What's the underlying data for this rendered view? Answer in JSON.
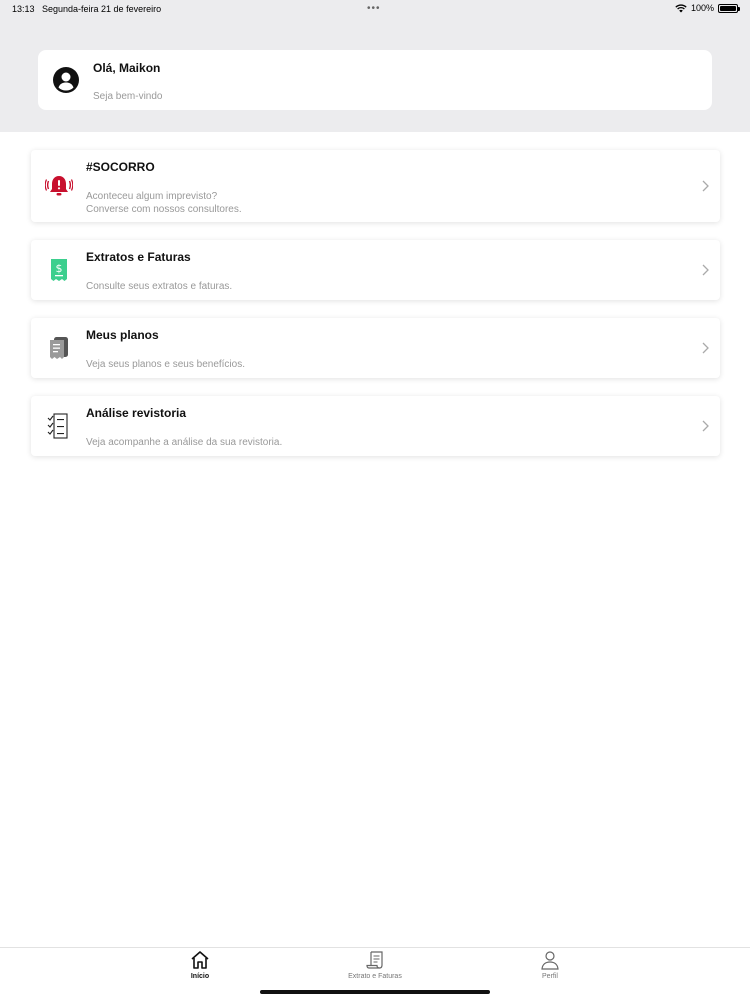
{
  "status_bar": {
    "time": "13:13",
    "date": "Segunda-feira 21 de fevereiro",
    "dots": "•••",
    "battery": "100%",
    "battery_level": 1.0
  },
  "greeting": {
    "title": "Olá, Maikon",
    "subtitle": "Seja bem-vindo",
    "icon": "user-circle-icon"
  },
  "menu": {
    "items": [
      {
        "title": "#SOCORRO",
        "desc_line1": "Aconteceu algum imprevisto?",
        "desc_line2": "Converse com nossos consultores.",
        "icon": "alarm-bell-icon",
        "icon_color": "#c8102e"
      },
      {
        "title": "Extratos e Faturas",
        "desc_line1": "Consulte seus extratos e faturas.",
        "icon": "dollar-receipt-icon",
        "icon_color": "#3ccf8e"
      },
      {
        "title": "Meus planos",
        "desc_line1": "Veja seus planos e seus benefícios.",
        "icon": "document-stack-icon",
        "icon_color": "#7a7a7a"
      },
      {
        "title": "Análise revistoria",
        "desc_line1": "Veja acompanhe a análise da sua revistoria.",
        "icon": "checklist-icon",
        "icon_color": "#222222"
      }
    ]
  },
  "tabs": [
    {
      "label": "Início",
      "icon": "home-icon",
      "active": true
    },
    {
      "label": "Extrato e Faturas",
      "icon": "receipt-icon",
      "active": false
    },
    {
      "label": "Perfil",
      "icon": "person-icon",
      "active": false
    }
  ]
}
